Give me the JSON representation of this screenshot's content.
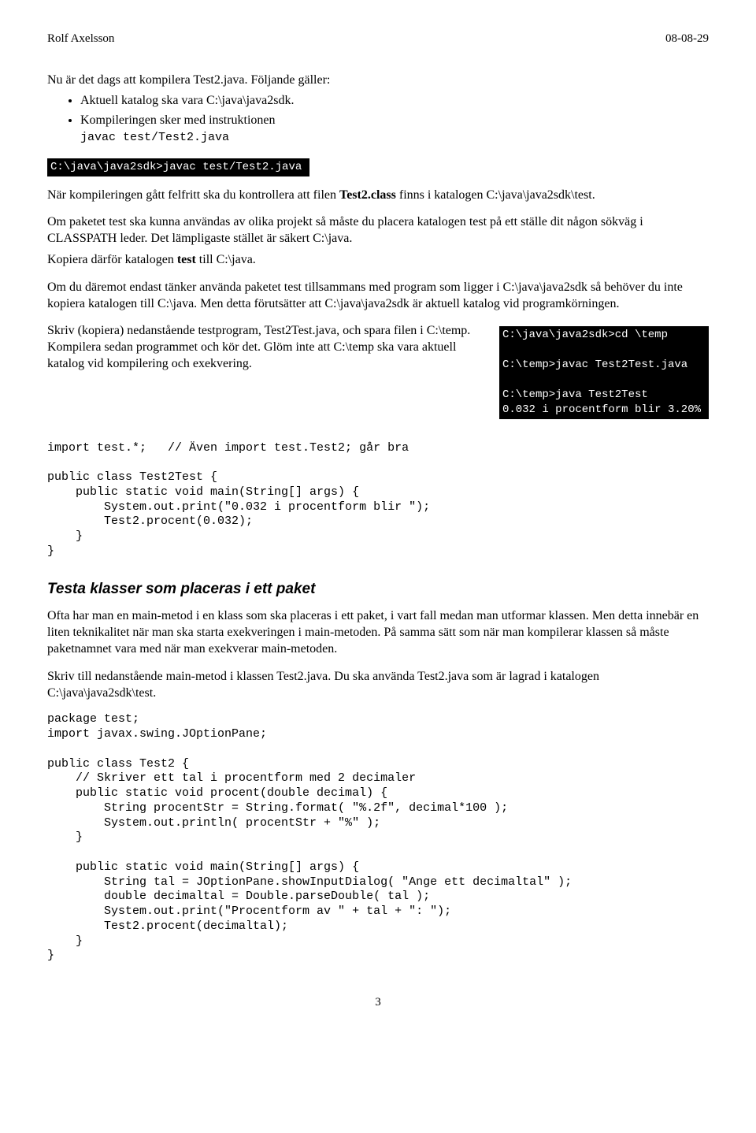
{
  "header": {
    "author": "Rolf Axelsson",
    "date": "08-08-29"
  },
  "intro": "Nu är det dags att kompilera Test2.java. Följande gäller:",
  "bullets": {
    "b1": "Aktuell katalog ska vara C:\\java\\java2sdk.",
    "b2a": "Kompileringen sker med instruktionen",
    "b2b": "javac test/Test2.java"
  },
  "cmd1": "C:\\java\\java2sdk>javac test/Test2.java",
  "p1a": "När kompileringen gått felfritt ska du kontrollera att filen ",
  "p1b": "Test2.class",
  "p1c": " finns i katalogen C:\\java\\java2sdk\\test.",
  "p2": "Om paketet test ska kunna användas av olika projekt så måste du placera katalogen test på ett ställe dit någon sökväg i CLASSPATH leder. Det lämpligaste stället är säkert C:\\java.",
  "p2b_a": "Kopiera därför katalogen ",
  "p2b_b": "test",
  "p2b_c": " till C:\\java.",
  "p3": "Om du däremot endast tänker använda paketet test tillsammans med program som ligger i C:\\java\\java2sdk så behöver du inte kopiera katalogen till C:\\java. Men detta förutsätter att C:\\java\\java2sdk är aktuell katalog vid programkörningen.",
  "p4": "Skriv (kopiera) nedanstående testprogram, Test2Test.java, och spara filen i C:\\temp. Kompilera sedan programmet och kör det. Glöm inte att C:\\temp ska vara aktuell katalog vid kompilering och exekvering.",
  "cmd2": "C:\\java\\java2sdk>cd \\temp\n\nC:\\temp>javac Test2Test.java\n\nC:\\temp>java Test2Test\n0.032 i procentform blir 3.20%",
  "code1": "import test.*;   // Även import test.Test2; går bra\n\npublic class Test2Test {\n    public static void main(String[] args) {\n        System.out.print(\"0.032 i procentform blir \");\n        Test2.procent(0.032);\n    }\n}",
  "h3": "Testa klasser som placeras i ett paket",
  "p5": "Ofta har man en main-metod i en klass som ska placeras i ett paket, i vart fall medan man utformar klassen. Men detta innebär en liten teknikalitet när man ska starta exekveringen i main-metoden. På samma sätt som när man kompilerar klassen så måste paketnamnet vara med när man exekverar main-metoden.",
  "p6": "Skriv till nedanstående main-metod i klassen Test2.java. Du ska använda Test2.java som är lagrad i katalogen C:\\java\\java2sdk\\test.",
  "code2": "package test;\nimport javax.swing.JOptionPane;\n\npublic class Test2 {\n    // Skriver ett tal i procentform med 2 decimaler\n    public static void procent(double decimal) {\n        String procentStr = String.format( \"%.2f\", decimal*100 );\n        System.out.println( procentStr + \"%\" );\n    }\n\n    public static void main(String[] args) {\n        String tal = JOptionPane.showInputDialog( \"Ange ett decimaltal\" );\n        double decimaltal = Double.parseDouble( tal );\n        System.out.print(\"Procentform av \" + tal + \": \");\n        Test2.procent(decimaltal);\n    }\n}",
  "pagenum": "3"
}
